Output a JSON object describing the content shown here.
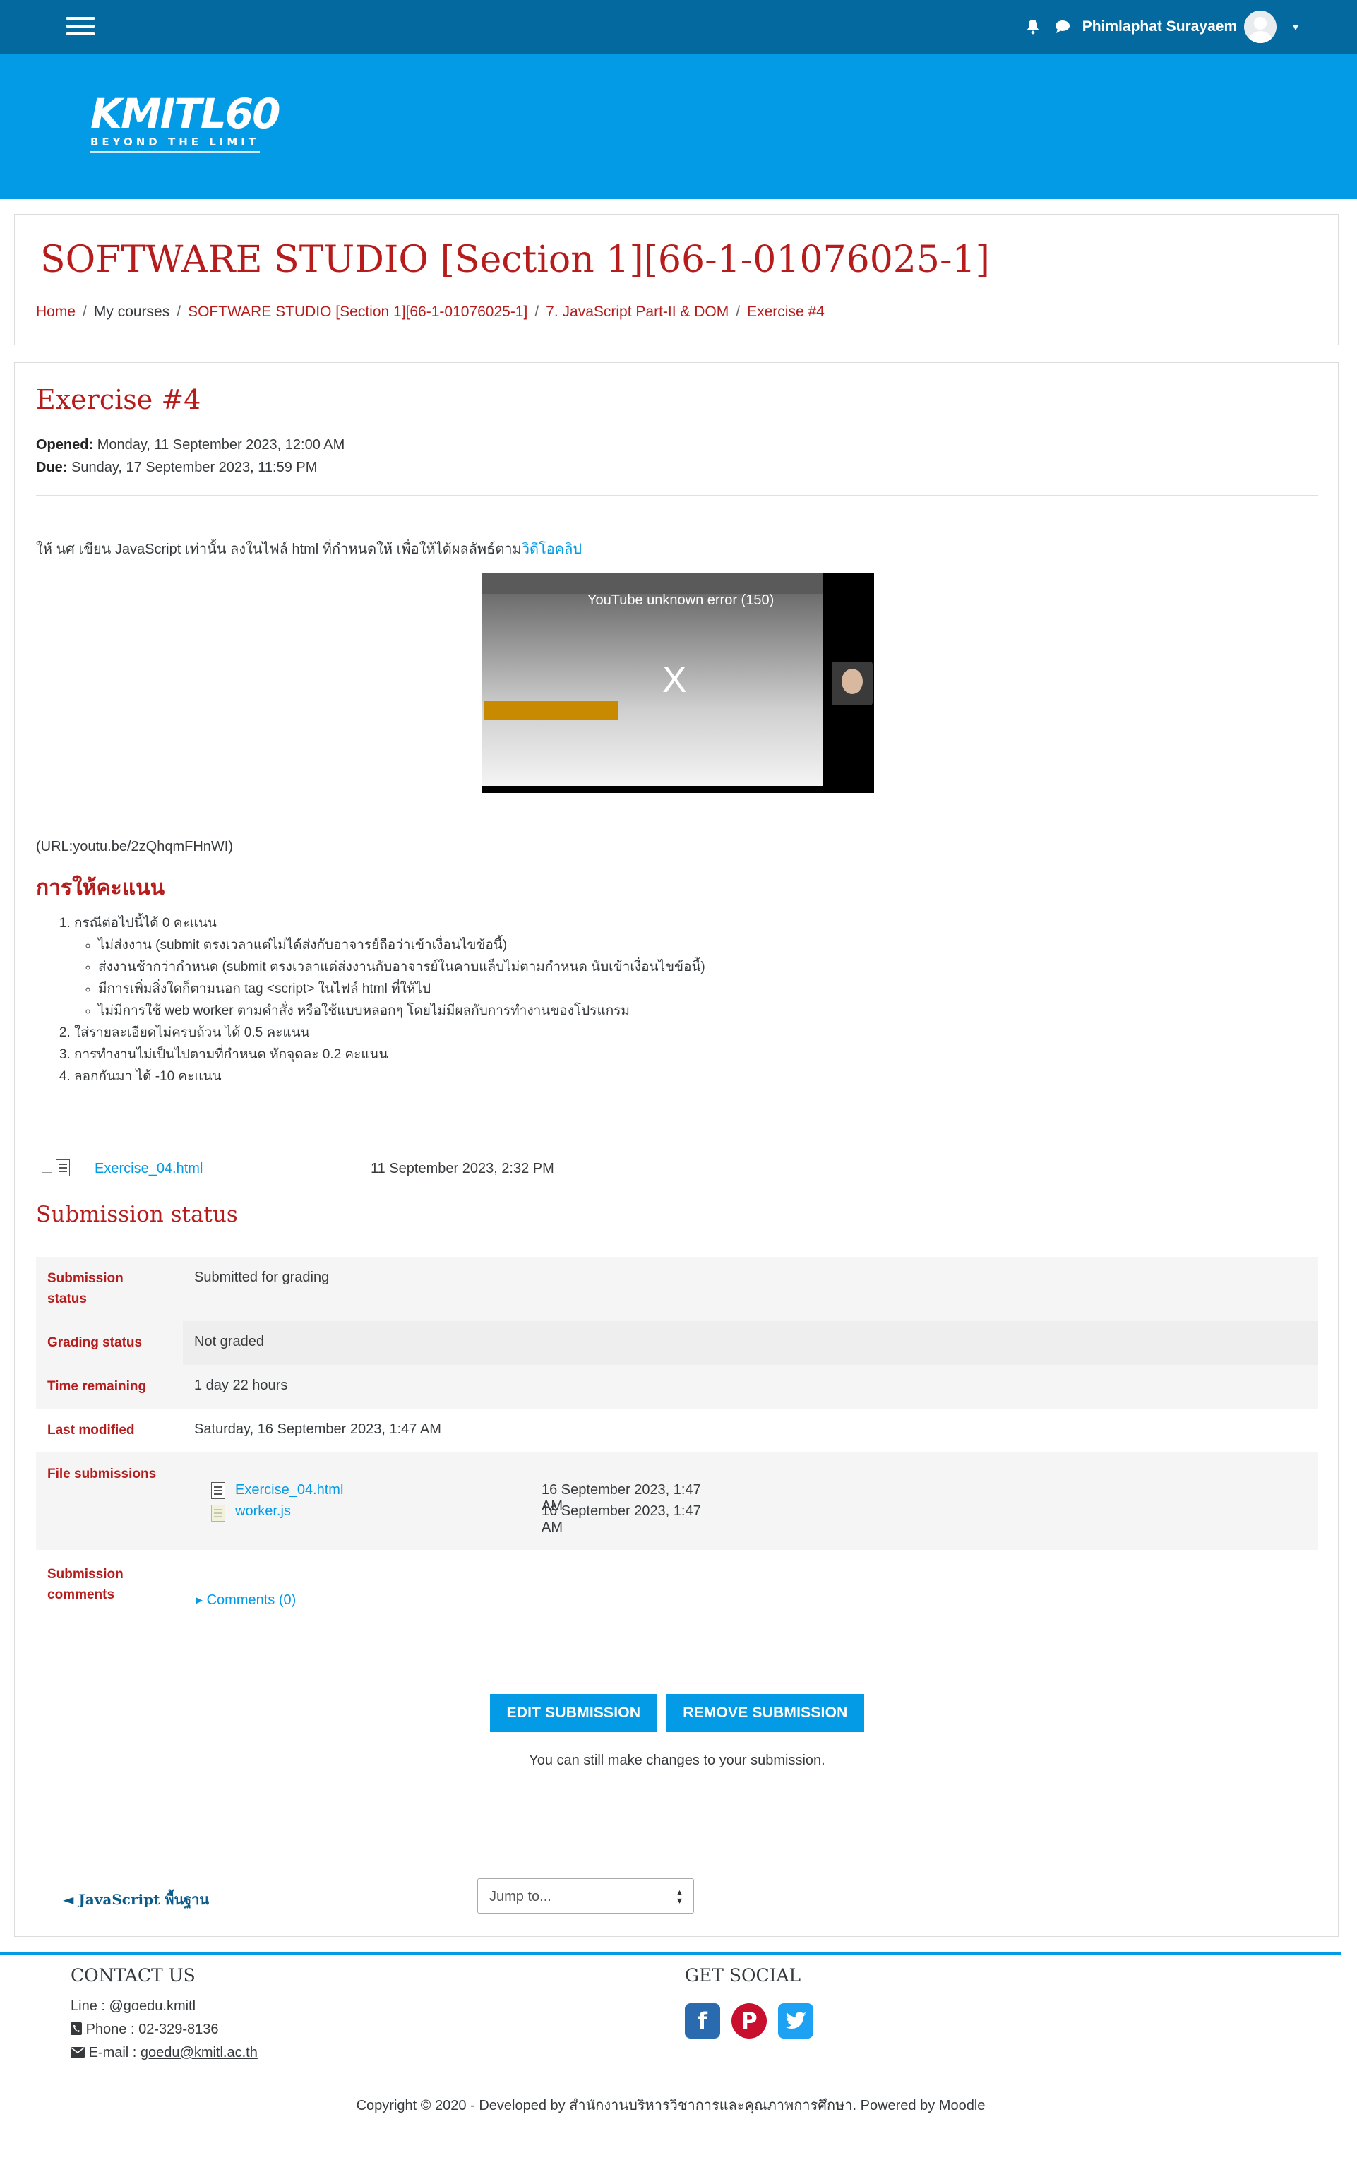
{
  "navbar": {
    "user_name": "Phimlaphat Surayaem",
    "colors": {
      "navbar_bg": "#03699e",
      "banner_bg": "#039be5"
    }
  },
  "banner": {
    "logo_main": "KMITL60",
    "logo_sub": "BEYOND THE LIMIT"
  },
  "course": {
    "title": "SOFTWARE STUDIO [Section 1][66-1-01076025-1]"
  },
  "breadcrumb": [
    {
      "label": "Home",
      "link": true
    },
    {
      "label": "My courses",
      "link": false
    },
    {
      "label": "SOFTWARE STUDIO [Section 1][66-1-01076025-1]",
      "link": true
    },
    {
      "label": "7. JavaScript Part-II & DOM",
      "link": true
    },
    {
      "label": "Exercise #4",
      "link": true
    }
  ],
  "assignment": {
    "title": "Exercise #4",
    "opened_label": "Opened:",
    "opened_value": "Monday, 11 September 2023, 12:00 AM",
    "due_label": "Due:",
    "due_value": "Sunday, 17 September 2023, 11:59 PM",
    "intro_text": "ให้ นศ เขียน JavaScript เท่านั้น ลงในไฟล์ html ที่กำหนดให้ เพื่อให้ได้ผลลัพธ์ตาม",
    "intro_link": "วิดีโอคลิป",
    "video_error": "YouTube unknown error (150)",
    "video_close": "X",
    "url_text": "(URL:youtu.be/2zQhqmFHnWI)",
    "grading_title": "การให้คะแนน",
    "rules": [
      {
        "text": "กรณีต่อไปนี้ได้ 0 คะแนน",
        "sub": [
          "ไม่ส่งงาน (submit ตรงเวลาแต่ไม่ได้ส่งกับอาจารย์ถือว่าเข้าเงื่อนไขข้อนี้)",
          "ส่งงานช้ากว่ากำหนด (submit ตรงเวลาแต่ส่งงานกับอาจารย์ในคาบแล็บไม่ตามกำหนด นับเข้าเงื่อนไขข้อนี้)",
          "มีการเพิ่มสิ่งใดก็ตามนอก tag <script> ในไฟล์ html ที่ให้ไป",
          "ไม่มีการใช้ web worker ตามคำสั่ง หรือใช้แบบหลอกๆ โดยไม่มีผลกับการทำงานของโปรแกรม"
        ]
      },
      {
        "text": "ใส่รายละเอียดไม่ครบถ้วน ได้ 0.5 คะแนน",
        "sub": []
      },
      {
        "text": "การทำงานไม่เป็นไปตามที่กำหนด หักจุดละ 0.2 คะแนน",
        "sub": []
      },
      {
        "text": "ลอกกันมา ได้ -10 คะแนน",
        "sub": []
      }
    ],
    "attachment": {
      "name": "Exercise_04.html",
      "time": "11 September 2023, 2:32 PM"
    }
  },
  "submission": {
    "title": "Submission status",
    "rows": {
      "status_label": "Submission status",
      "status_value": "Submitted for grading",
      "grading_label": "Grading status",
      "grading_value": "Not graded",
      "time_label": "Time remaining",
      "time_value": "1 day 22 hours",
      "modified_label": "Last modified",
      "modified_value": "Saturday, 16 September 2023, 1:47 AM",
      "files_label": "File submissions",
      "comments_label": "Submission comments",
      "comments_link": "Comments (0)"
    },
    "files": [
      {
        "name": "Exercise_04.html",
        "time": "16 September 2023, 1:47 AM",
        "icon": "html-file-icon"
      },
      {
        "name": "worker.js",
        "time": "16 September 2023, 1:47 AM",
        "icon": "js-file-icon"
      }
    ],
    "edit_button": "EDIT SUBMISSION",
    "remove_button": "REMOVE SUBMISSION",
    "note": "You can still make changes to your submission."
  },
  "navigation": {
    "prev_link": "◄ JavaScript พื้นฐาน",
    "jump_placeholder": "Jump to..."
  },
  "footer": {
    "contact_title": "CONTACT US",
    "line": "Line : @goedu.kmitl",
    "phone": "Phone : 02-329-8136",
    "email_prefix": "E-mail : ",
    "email": "goedu@kmitl.ac.th",
    "social_title": "GET SOCIAL",
    "copyright": "Copyright © 2020 - Developed by สำนักงานบริหารวิชาการและคุณภาพการศึกษา. Powered by Moodle"
  }
}
